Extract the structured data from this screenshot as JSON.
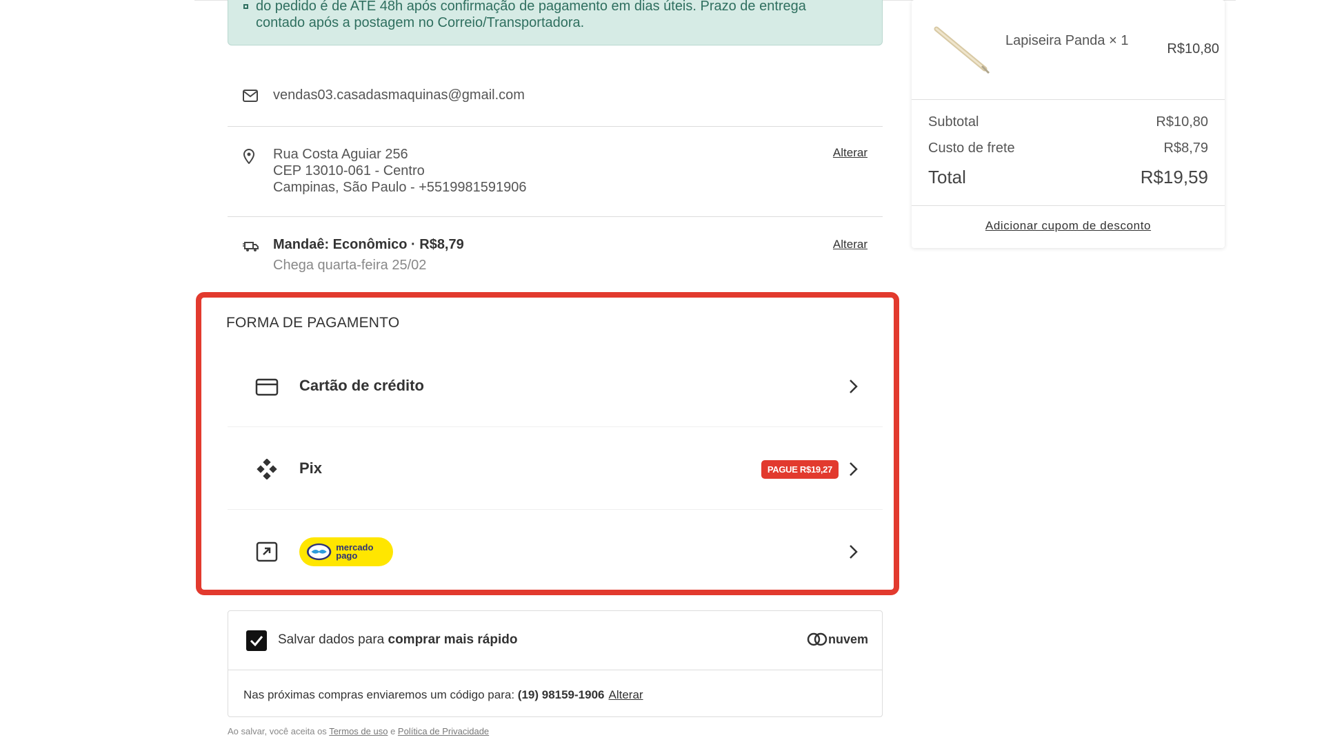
{
  "notice": {
    "line1": "do pedido é de ATÉ 48h após confirmação de pagamento em dias úteis. Prazo de entrega",
    "line2": "contado após a postagem no Correio/Transportadora."
  },
  "contact": {
    "email": "vendas03.casadasmaquinas@gmail.com"
  },
  "address": {
    "line1": "Rua Costa Aguiar 256",
    "line2": "CEP 13010-061 - Centro",
    "line3": "Campinas, São Paulo - +5519981591906",
    "change_label": "Alterar"
  },
  "shipping": {
    "title": "Mandaê: Econômico · R$8,79",
    "eta": "Chega quarta-feira 25/02",
    "change_label": "Alterar"
  },
  "payment": {
    "title": "FORMA DE PAGAMENTO",
    "options": [
      {
        "label": "Cartão de crédito",
        "icon": "credit-card-icon"
      },
      {
        "label": "Pix",
        "icon": "pix-icon",
        "badge": "PAGUE R$19,27"
      },
      {
        "label": "mercado pago",
        "icon": "external-link-icon"
      }
    ],
    "highlight_color": "#e23a2e"
  },
  "save": {
    "label_prefix": "Salvar dados para ",
    "label_bold": "comprar mais rápido",
    "brand": "nuvem",
    "code_text": "Nas próximas compras enviaremos um código para: ",
    "phone": "(19) 98159-1906",
    "change_label": "Alterar",
    "checked": true
  },
  "terms": {
    "prefix": "Ao salvar, você aceita os ",
    "terms_link": "Termos de uso",
    "and": " e ",
    "privacy_link": "Política de Privacidade"
  },
  "summary": {
    "product_name": "Lapiseira Panda × 1",
    "product_price": "R$10,80",
    "subtotal_label": "Subtotal",
    "subtotal": "R$10,80",
    "shipping_label": "Custo de frete",
    "shipping": "R$8,79",
    "total_label": "Total",
    "total": "R$19,59",
    "coupon_label": "Adicionar cupom de desconto"
  }
}
